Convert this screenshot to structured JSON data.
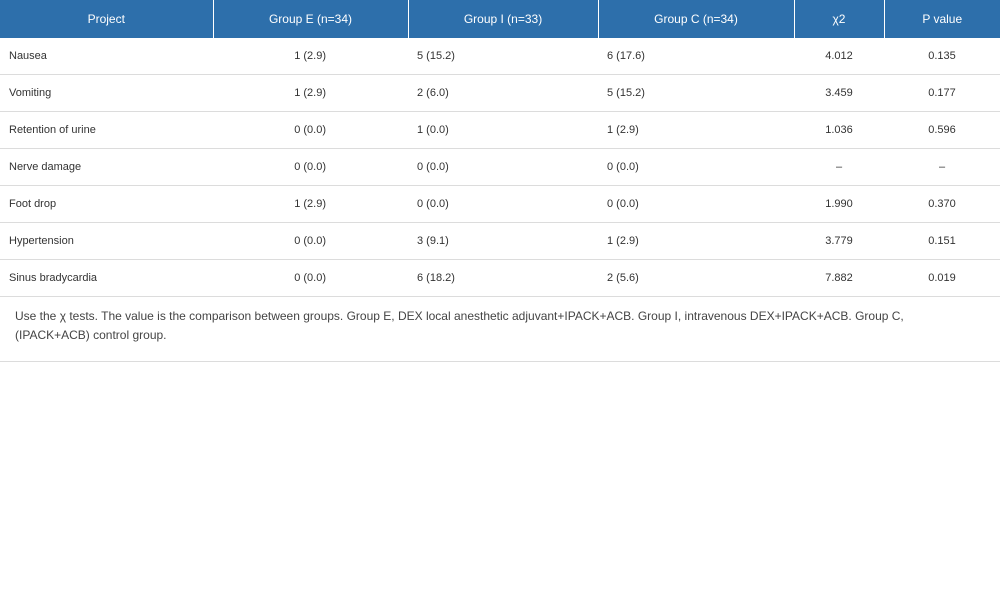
{
  "table": {
    "headers": [
      "Project",
      "Group E (n=34)",
      "Group I (n=33)",
      "Group C (n=34)",
      "χ2",
      "P value"
    ],
    "rows": [
      [
        "Nausea",
        "1 (2.9)",
        "5 (15.2)",
        "6 (17.6)",
        "4.012",
        "0.135"
      ],
      [
        "Vomiting",
        "1 (2.9)",
        "2 (6.0)",
        "5 (15.2)",
        "3.459",
        "0.177"
      ],
      [
        "Retention of urine",
        "0 (0.0)",
        "1 (0.0)",
        "1 (2.9)",
        "1.036",
        "0.596"
      ],
      [
        "Nerve damage",
        "0 (0.0)",
        "0 (0.0)",
        "0 (0.0)",
        "–",
        "–"
      ],
      [
        "Foot drop",
        "1 (2.9)",
        "0 (0.0)",
        "0 (0.0)",
        "1.990",
        "0.370"
      ],
      [
        "Hypertension",
        "0 (0.0)",
        "3 (9.1)",
        "1 (2.9)",
        "3.779",
        "0.151"
      ],
      [
        "Sinus bradycardia",
        "0 (0.0)",
        "6 (18.2)",
        "2 (5.6)",
        "7.882",
        "0.019"
      ]
    ],
    "footnote": "Use the χ tests. The value is the comparison between groups. Group E, DEX local anesthetic adjuvant+IPACK+ACB. Group I, intravenous DEX+IPACK+ACB. Group C, (IPACK+ACB) control group."
  },
  "colors": {
    "header_bg": "#2d6fab",
    "header_text": "#ffffff",
    "row_border": "#dcdcdc"
  }
}
